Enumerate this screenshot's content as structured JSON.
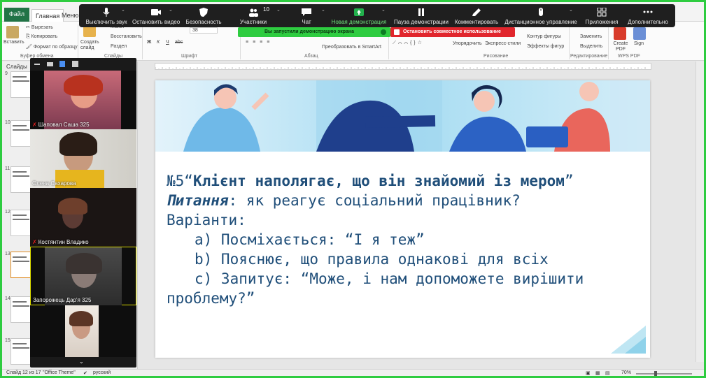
{
  "ribbon": {
    "tabs": {
      "file": "Файл",
      "home": "Главная",
      "menu": "Меню"
    },
    "clipboard": {
      "paste": "Вставить",
      "cut": "Вырезать",
      "copy": "Копировать",
      "format_painter": "Формат по образцу",
      "group_label": "Буфер обмена"
    },
    "slides": {
      "new_slide": "Создать слайд",
      "layout": "Макет",
      "reset": "Восстановить",
      "section": "Раздел",
      "group_label": "Слайды"
    },
    "font": {
      "size": "38",
      "group_label": "Шрифт"
    },
    "paragraph": {
      "smartart": "Преобразовать в SmartArt",
      "group_label": "Абзац"
    },
    "drawing": {
      "arrange": "Упорядочить",
      "quick_styles": "Экспресс-стили",
      "shape_outline": "Контур фигуры",
      "shape_effects": "Эффекты фигур",
      "group_label": "Рисование"
    },
    "editing": {
      "replace": "Заменить",
      "select": "Выделить",
      "group_label": "Редактирование"
    },
    "wps": {
      "create_pdf": "Create PDF",
      "sign": "Sign",
      "group_label": "WPS PDF"
    }
  },
  "zoom_toolbar": {
    "mute": "Выключить звук",
    "stop_video": "Остановить видео",
    "security": "Безопасность",
    "participants": "Участники",
    "participants_count": "10",
    "chat": "Чат",
    "new_share": "Новая демонстрация",
    "pause_share": "Пауза демонстрации",
    "annotate": "Комментировать",
    "remote_control": "Дистанционное управление",
    "apps": "Приложения",
    "more": "Дополнительно",
    "sharing_notice": "Вы запустили демонстрацию экрана",
    "stop_share": "Остановить совместное использование"
  },
  "slides_pane": {
    "label": "Слайды",
    "numbers": [
      "9",
      "10",
      "11",
      "12",
      "13",
      "14",
      "15"
    ]
  },
  "participants": [
    {
      "name": "Шаповал Саша 325",
      "muted": true
    },
    {
      "name": "Олена Сахарова",
      "muted": false
    },
    {
      "name": "Костянтин Владико",
      "muted": true
    },
    {
      "name": "Запорожець Дар'я 325",
      "muted": false
    }
  ],
  "slide": {
    "line1_prefix": "№5“",
    "line1_bold": "Клієнт наполягає, що він знайомий із мером",
    "line1_suffix": "”",
    "line2_bold": "Питання",
    "line2_rest": ": як реагує соціальний працівник?",
    "line3": "Варіанти:",
    "option_a": "a) Посміхається: “І я теж”",
    "option_b": "b) Пояснює, що правила однакові для всіх",
    "option_c": "c) Запитує: “Може, і нам допоможете вирішити",
    "line_last": "проблему?”"
  },
  "status_bar": {
    "slide_info": "Слайд 12 из 17",
    "theme": "\"Office Theme\"",
    "language": "русский",
    "zoom": "70%"
  },
  "colors": {
    "slide_text": "#1f4e79",
    "share_green": "#2ecc40",
    "stop_red": "#e1262d",
    "excel_green": "#217346"
  }
}
